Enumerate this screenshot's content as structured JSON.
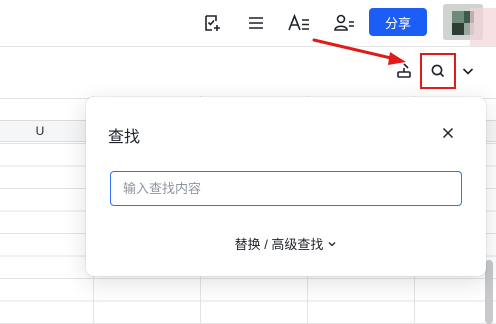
{
  "toolbar": {
    "icons": [
      "task-add-icon",
      "menu-icon",
      "text-format-icon",
      "collaborators-icon"
    ],
    "share_label": "分享",
    "accent_color": "#1c5ef5"
  },
  "subbar": {
    "icons": [
      "format-painter-icon",
      "search-icon",
      "chevron-down-icon"
    ]
  },
  "sheet": {
    "column_label": "U"
  },
  "find_dialog": {
    "title": "查找",
    "search_placeholder": "输入查找内容",
    "search_value": "",
    "advanced_label": "替换 / 高级查找"
  },
  "annotation": {
    "color": "#e01b1b"
  }
}
